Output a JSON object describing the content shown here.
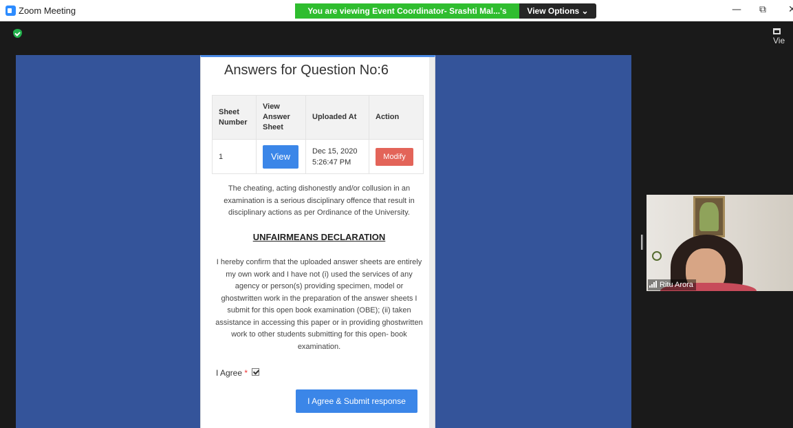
{
  "window": {
    "title": "Zoom Meeting",
    "share_banner": "You are viewing Event Coordinator- Srashti Mal...'s screen",
    "view_options": "View Options ⌄",
    "minimize": "—",
    "restore": "⧉",
    "close": "✕",
    "view_top": "Vie"
  },
  "page": {
    "title": "Answers for Question No:6",
    "table": {
      "headers": [
        "Sheet Number",
        "View Answer Sheet",
        "Uploaded At",
        "Action"
      ],
      "rows": [
        {
          "sheet_number": "1",
          "view_label": "View",
          "uploaded_date": "Dec 15, 2020",
          "uploaded_time": "5:26:47 PM",
          "action_label": "Modify"
        }
      ]
    },
    "warning": "The cheating, acting dishonestly and/or collusion in an examination is a serious disciplinary offence that result in disciplinary actions as per Ordinance of the University.",
    "declaration_heading": "UNFAIRMEANS DECLARATION",
    "declaration_body": "I hereby confirm that the uploaded answer sheets are entirely my own work and I have not (i) used the services of any agency or person(s) providing specimen, model or ghostwritten work in the preparation of the answer sheets I submit for this open book examination (OBE); (ii) taken assistance in accessing this paper or in providing ghostwritten work to other students submitting for this open- book examination.",
    "agree_label": "I Agree",
    "agree_required_mark": "*",
    "agree_checked": true,
    "submit_label": "I Agree & Submit response"
  },
  "participant": {
    "name": "Ritu Arora"
  },
  "colors": {
    "share_banner": "#2fbd2f",
    "shared_background": "#34549a",
    "primary_button": "#3b86e8",
    "danger_button": "#e36459"
  }
}
